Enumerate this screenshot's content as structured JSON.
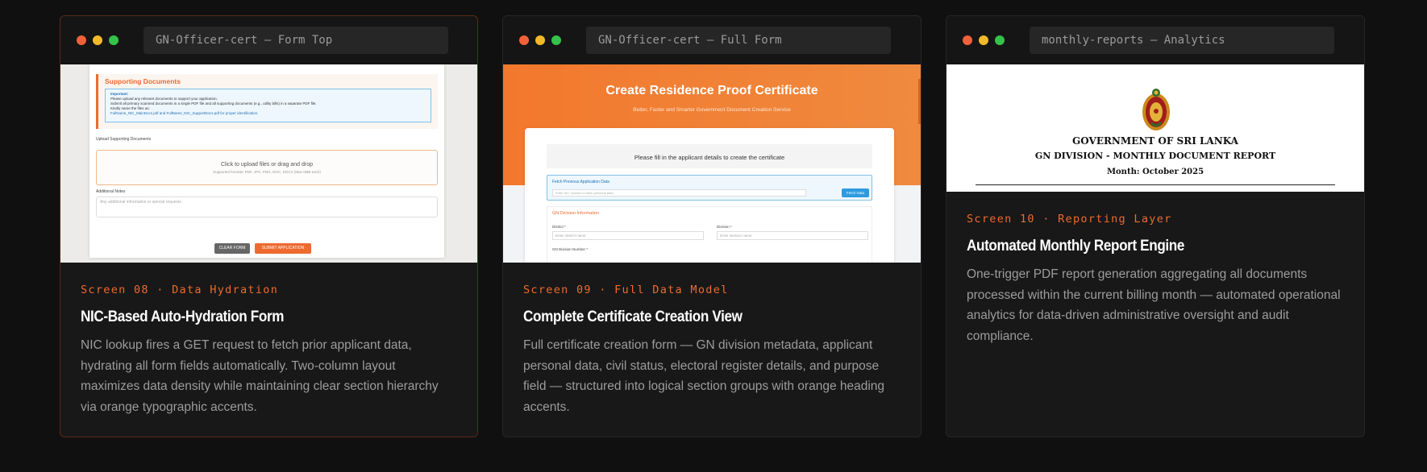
{
  "cards": [
    {
      "window_title": "GN-Officer-cert — Form Top",
      "eyebrow": "Screen 08 · Data Hydration",
      "title": "NIC-Based Auto-Hydration Form",
      "description": "NIC lookup fires a GET request to fetch prior applicant data, hydrating all form fields automatically. Two-column layout maximizes data density while maintaining clear section hierarchy via orange typographic accents.",
      "screenshot": {
        "section_title": "Supporting Documents",
        "note_heading": "Important:",
        "note_lines": [
          "Please upload any relevant documents to support your application.",
          "Submit all primary scanned documents in a single PDF file and all supporting documents (e.g., utility bills) in a separate PDF file.",
          "Kindly name the files as:",
          "FullName_NIC_MainDocs.pdf and FullName_NIC_SupportDocs.pdf for proper identification."
        ],
        "upload_label": "Upload Supporting Documents",
        "drop_text": "Click to upload files or drag and drop",
        "drop_sub": "Supported formats: PDF, JPG, PNG, DOC, DOCX (Max 5MB each)",
        "notes_label": "Additional Notes",
        "notes_placeholder": "Any additional information or special requests",
        "clear_button": "CLEAR FORM",
        "submit_button": "SUBMIT APPLICATION"
      }
    },
    {
      "window_title": "GN-Officer-cert — Full Form",
      "eyebrow": "Screen 09 · Full Data Model",
      "title": "Complete Certificate Creation View",
      "description": "Full certificate creation form — GN division metadata, applicant personal data, civil status, electoral register details, and purpose field — structured into logical section groups with orange heading accents.",
      "screenshot": {
        "hero_title": "Create Residence Proof Certificate",
        "hero_subtitle": "Better, Faster and Smarter Government Document Creation Service",
        "intro": "Please fill in the applicant details to create the certificate",
        "fetch_title": "Fetch Previous Application Data",
        "fetch_placeholder": "Enter NIC number to fetch previous data",
        "fetch_button": "Fetch Data",
        "gn_section": "GN Division Information",
        "district_label": "District *",
        "district_placeholder": "Enter district name",
        "division_label": "Division *",
        "division_placeholder": "Enter division name",
        "gn_number_label": "GN Division Number *"
      }
    },
    {
      "window_title": "monthly-reports — Analytics",
      "eyebrow": "Screen 10 · Reporting Layer",
      "title": "Automated Monthly Report Engine",
      "description": "One-trigger PDF report generation aggregating all documents processed within the current billing month — automated operational analytics for data-driven administrative oversight and audit compliance.",
      "screenshot": {
        "line1": "GOVERNMENT OF SRI LANKA",
        "line2": "GN DIVISION - MONTHLY DOCUMENT REPORT",
        "line3": "Month: October 2025"
      }
    }
  ],
  "colors": {
    "accent": "#ee6a2e",
    "background": "#101010",
    "card": "#181818"
  },
  "icons": [
    "close-dot-icon",
    "minimize-dot-icon",
    "maximize-dot-icon",
    "sri-lanka-emblem-icon"
  ]
}
